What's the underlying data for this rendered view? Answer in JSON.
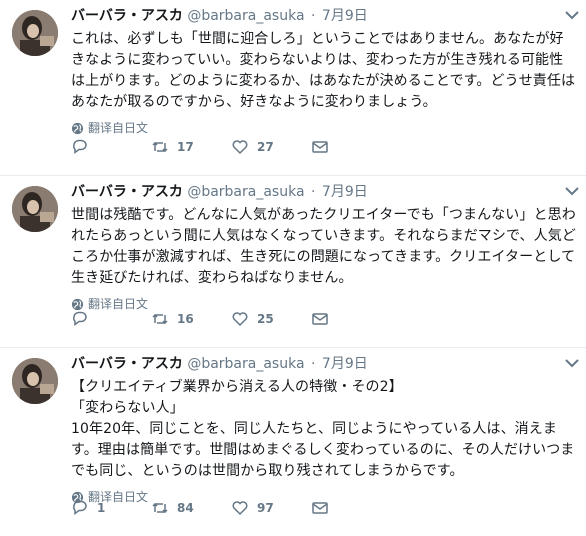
{
  "tweets": [
    {
      "name": "バーバラ・アスカ",
      "handle": "@barbara_asuka",
      "separator": "·",
      "date": "7月9日",
      "text": "これは、必ずしも「世間に迎合しろ」ということではありません。あなたが好きなように変わっていい。変わらないよりは、変わった方が生き残れる可能性は上がります。どのように変わるか、はあなたが決めることです。どうせ責任はあなたが取るのですから、好きなように変わりましょう。",
      "translate": "翻译自日文",
      "reply_count": "",
      "retweet_count": "17",
      "like_count": "27"
    },
    {
      "name": "バーバラ・アスカ",
      "handle": "@barbara_asuka",
      "separator": "·",
      "date": "7月9日",
      "text": "世間は残酷です。どんなに人気があったクリエイターでも「つまんない」と思われたらあっという間に人気はなくなっていきます。それならまだマシで、人気どころか仕事が激減すれば、生き死にの問題になってきます。クリエイターとして生き延びたければ、変わらねばなりません。",
      "translate": "翻译自日文",
      "reply_count": "",
      "retweet_count": "16",
      "like_count": "25"
    },
    {
      "name": "バーバラ・アスカ",
      "handle": "@barbara_asuka",
      "separator": "·",
      "date": "7月9日",
      "text": "【クリエイティブ業界から消える人の特徴・その2】\n「変わらない人」\n10年20年、同じことを、同じ人たちと、同じようにやっている人は、消えます。理由は簡単です。世間はめまぐるしく変わっているのに、その人だけいつまでも同じ、というのは世間から取り残されてしまうからです。",
      "translate": "翻译自日文",
      "reply_count": "1",
      "retweet_count": "84",
      "like_count": "97"
    }
  ]
}
